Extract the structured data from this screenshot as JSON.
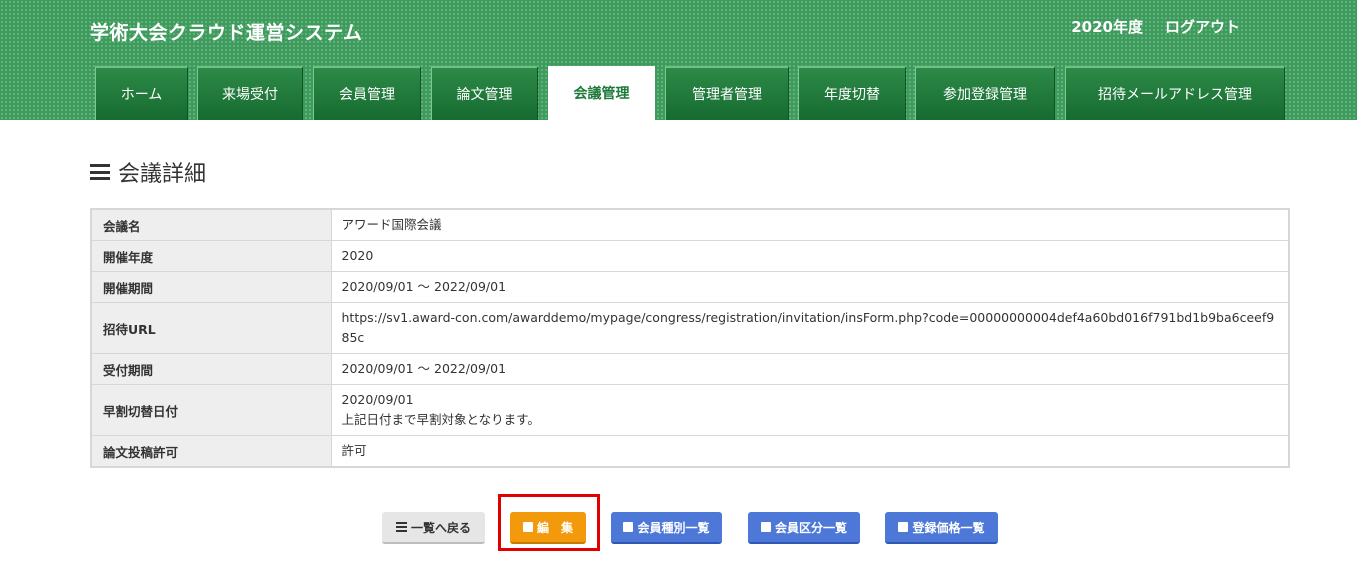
{
  "header": {
    "app_title": "学術大会クラウド運営システム",
    "fiscal_year": "2020年度",
    "logout_label": "ログアウト",
    "accent_color": "#3d9b5c"
  },
  "tabs": [
    {
      "label": "ホーム",
      "active": false
    },
    {
      "label": "来場受付",
      "active": false
    },
    {
      "label": "会員管理",
      "active": false
    },
    {
      "label": "論文管理",
      "active": false
    },
    {
      "label": "会議管理",
      "active": true
    },
    {
      "label": "管理者管理",
      "active": false
    },
    {
      "label": "年度切替",
      "active": false
    },
    {
      "label": "参加登録管理",
      "active": false
    },
    {
      "label": "招待メールアドレス管理",
      "active": false
    }
  ],
  "page": {
    "heading": "会議詳細",
    "heading_icon": "menu-icon"
  },
  "details": {
    "rows": [
      {
        "label": "会議名",
        "value": "アワード国際会議"
      },
      {
        "label": "開催年度",
        "value": "2020"
      },
      {
        "label": "開催期間",
        "value": "2020/09/01 ～ 2022/09/01"
      },
      {
        "label": "招待URL",
        "value": "https://sv1.award-con.com/awarddemo/mypage/congress/registration/invitation/insForm.php?code=00000000004def4a60bd016f791bd1b9ba6ceef985c"
      },
      {
        "label": "受付期間",
        "value": "2020/09/01 ～ 2022/09/01"
      },
      {
        "label": "早割切替日付",
        "value": "2020/09/01",
        "note": "上記日付まで早割対象となります。"
      },
      {
        "label": "論文投稿許可",
        "value": "許可"
      }
    ]
  },
  "actions": {
    "back_label": "一覧へ戻る",
    "edit_label": "編　集",
    "member_type_label": "会員種別一覧",
    "member_division_label": "会員区分一覧",
    "price_label": "登録価格一覧",
    "edit_color": "#f39a0c",
    "blue_color": "#4d78d8",
    "highlight_color": "#e00000"
  }
}
